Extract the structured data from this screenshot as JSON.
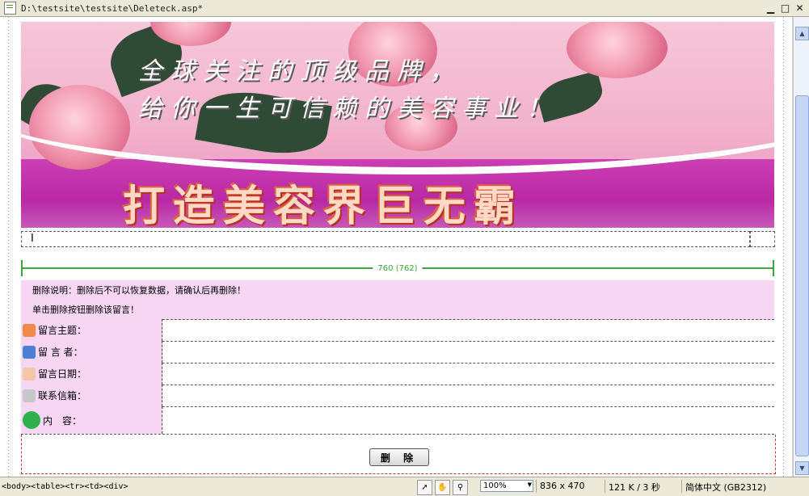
{
  "window": {
    "path": "D:\\testsite\\testsite\\Deleteck.asp*",
    "min_label": "▁",
    "max_label": "□",
    "close_label": "✕"
  },
  "banner": {
    "slogan_line1": "全球关注的顶级品牌，",
    "slogan_line2": "给你一生可信赖的美容事业！",
    "title": "打造美容界巨无霸"
  },
  "cursor_mark": "I",
  "table_width": "760 (762)",
  "messages": {
    "delete_note": "删除说明：删除后不可以恢复数据，请确认后再删除！",
    "delete_hint": "单击删除按钮删除该留言！"
  },
  "form": {
    "rows": [
      {
        "label": "留言主题：",
        "icon": "message-theme-icon",
        "color": "#f08a4b"
      },
      {
        "label": "留 言 者：",
        "icon": "author-icon",
        "color": "#4a7fd4"
      },
      {
        "label": "留言日期：",
        "icon": "date-icon",
        "color": "#f4c6a8"
      },
      {
        "label": "联系信箱：",
        "icon": "mail-icon",
        "color": "#c8c8c8"
      },
      {
        "label": "内　容：",
        "icon": "content-icon",
        "color": "#2db14a"
      }
    ]
  },
  "delete_button": "删 除",
  "statusbar": {
    "tags": "<body><table><tr><td><div>",
    "zoom": "100%",
    "dimensions": "836 x 470",
    "filesize": "121 K / 3 秒",
    "encoding": "简体中文 (GB2312)"
  }
}
